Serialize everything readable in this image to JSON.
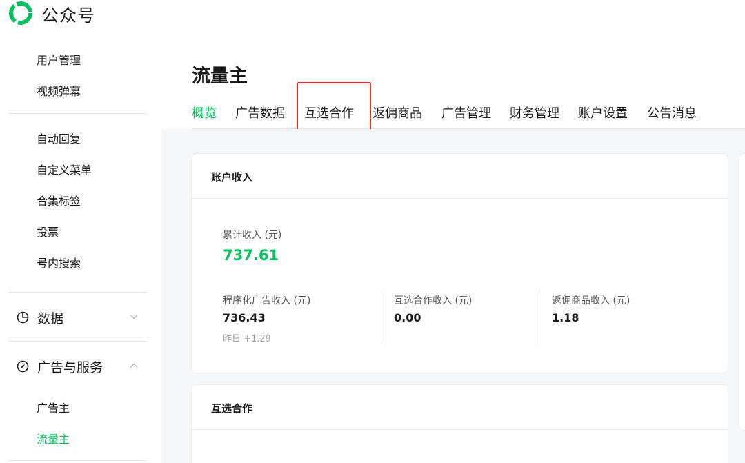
{
  "app": {
    "brand": "公众号"
  },
  "sidebar": {
    "items_top": [
      {
        "label": "用户管理"
      },
      {
        "label": "视频弹幕"
      }
    ],
    "items_mid": [
      {
        "label": "自动回复"
      },
      {
        "label": "自定义菜单"
      },
      {
        "label": "合集标签"
      },
      {
        "label": "投票"
      },
      {
        "label": "号内搜索"
      }
    ],
    "groups": [
      {
        "label": "数据",
        "icon": "pie-chart-icon",
        "expanded": false
      },
      {
        "label": "广告与服务",
        "icon": "compass-icon",
        "expanded": true
      }
    ],
    "items_ads": [
      {
        "label": "广告主",
        "active": false
      },
      {
        "label": "流量主",
        "active": true
      }
    ]
  },
  "main": {
    "title": "流量主",
    "tabs": [
      {
        "label": "概览",
        "active": true
      },
      {
        "label": "广告数据"
      },
      {
        "label": "互选合作",
        "highlighted": true
      },
      {
        "label": "返佣商品"
      },
      {
        "label": "广告管理"
      },
      {
        "label": "财务管理"
      },
      {
        "label": "账户设置"
      },
      {
        "label": "公告消息"
      }
    ],
    "income_card": {
      "title": "账户收入",
      "total_label": "累计收入 (元)",
      "total_value": "737.61",
      "breakdown": [
        {
          "label": "程序化广告收入 (元)",
          "value": "736.43",
          "sub": "昨日 +1.29"
        },
        {
          "label": "互选合作收入 (元)",
          "value": "0.00"
        },
        {
          "label": "返佣商品收入 (元)",
          "value": "1.18"
        }
      ]
    },
    "coop_card": {
      "title": "互选合作"
    }
  },
  "colors": {
    "accent": "#07c160",
    "highlight": "#ee2c2c"
  }
}
